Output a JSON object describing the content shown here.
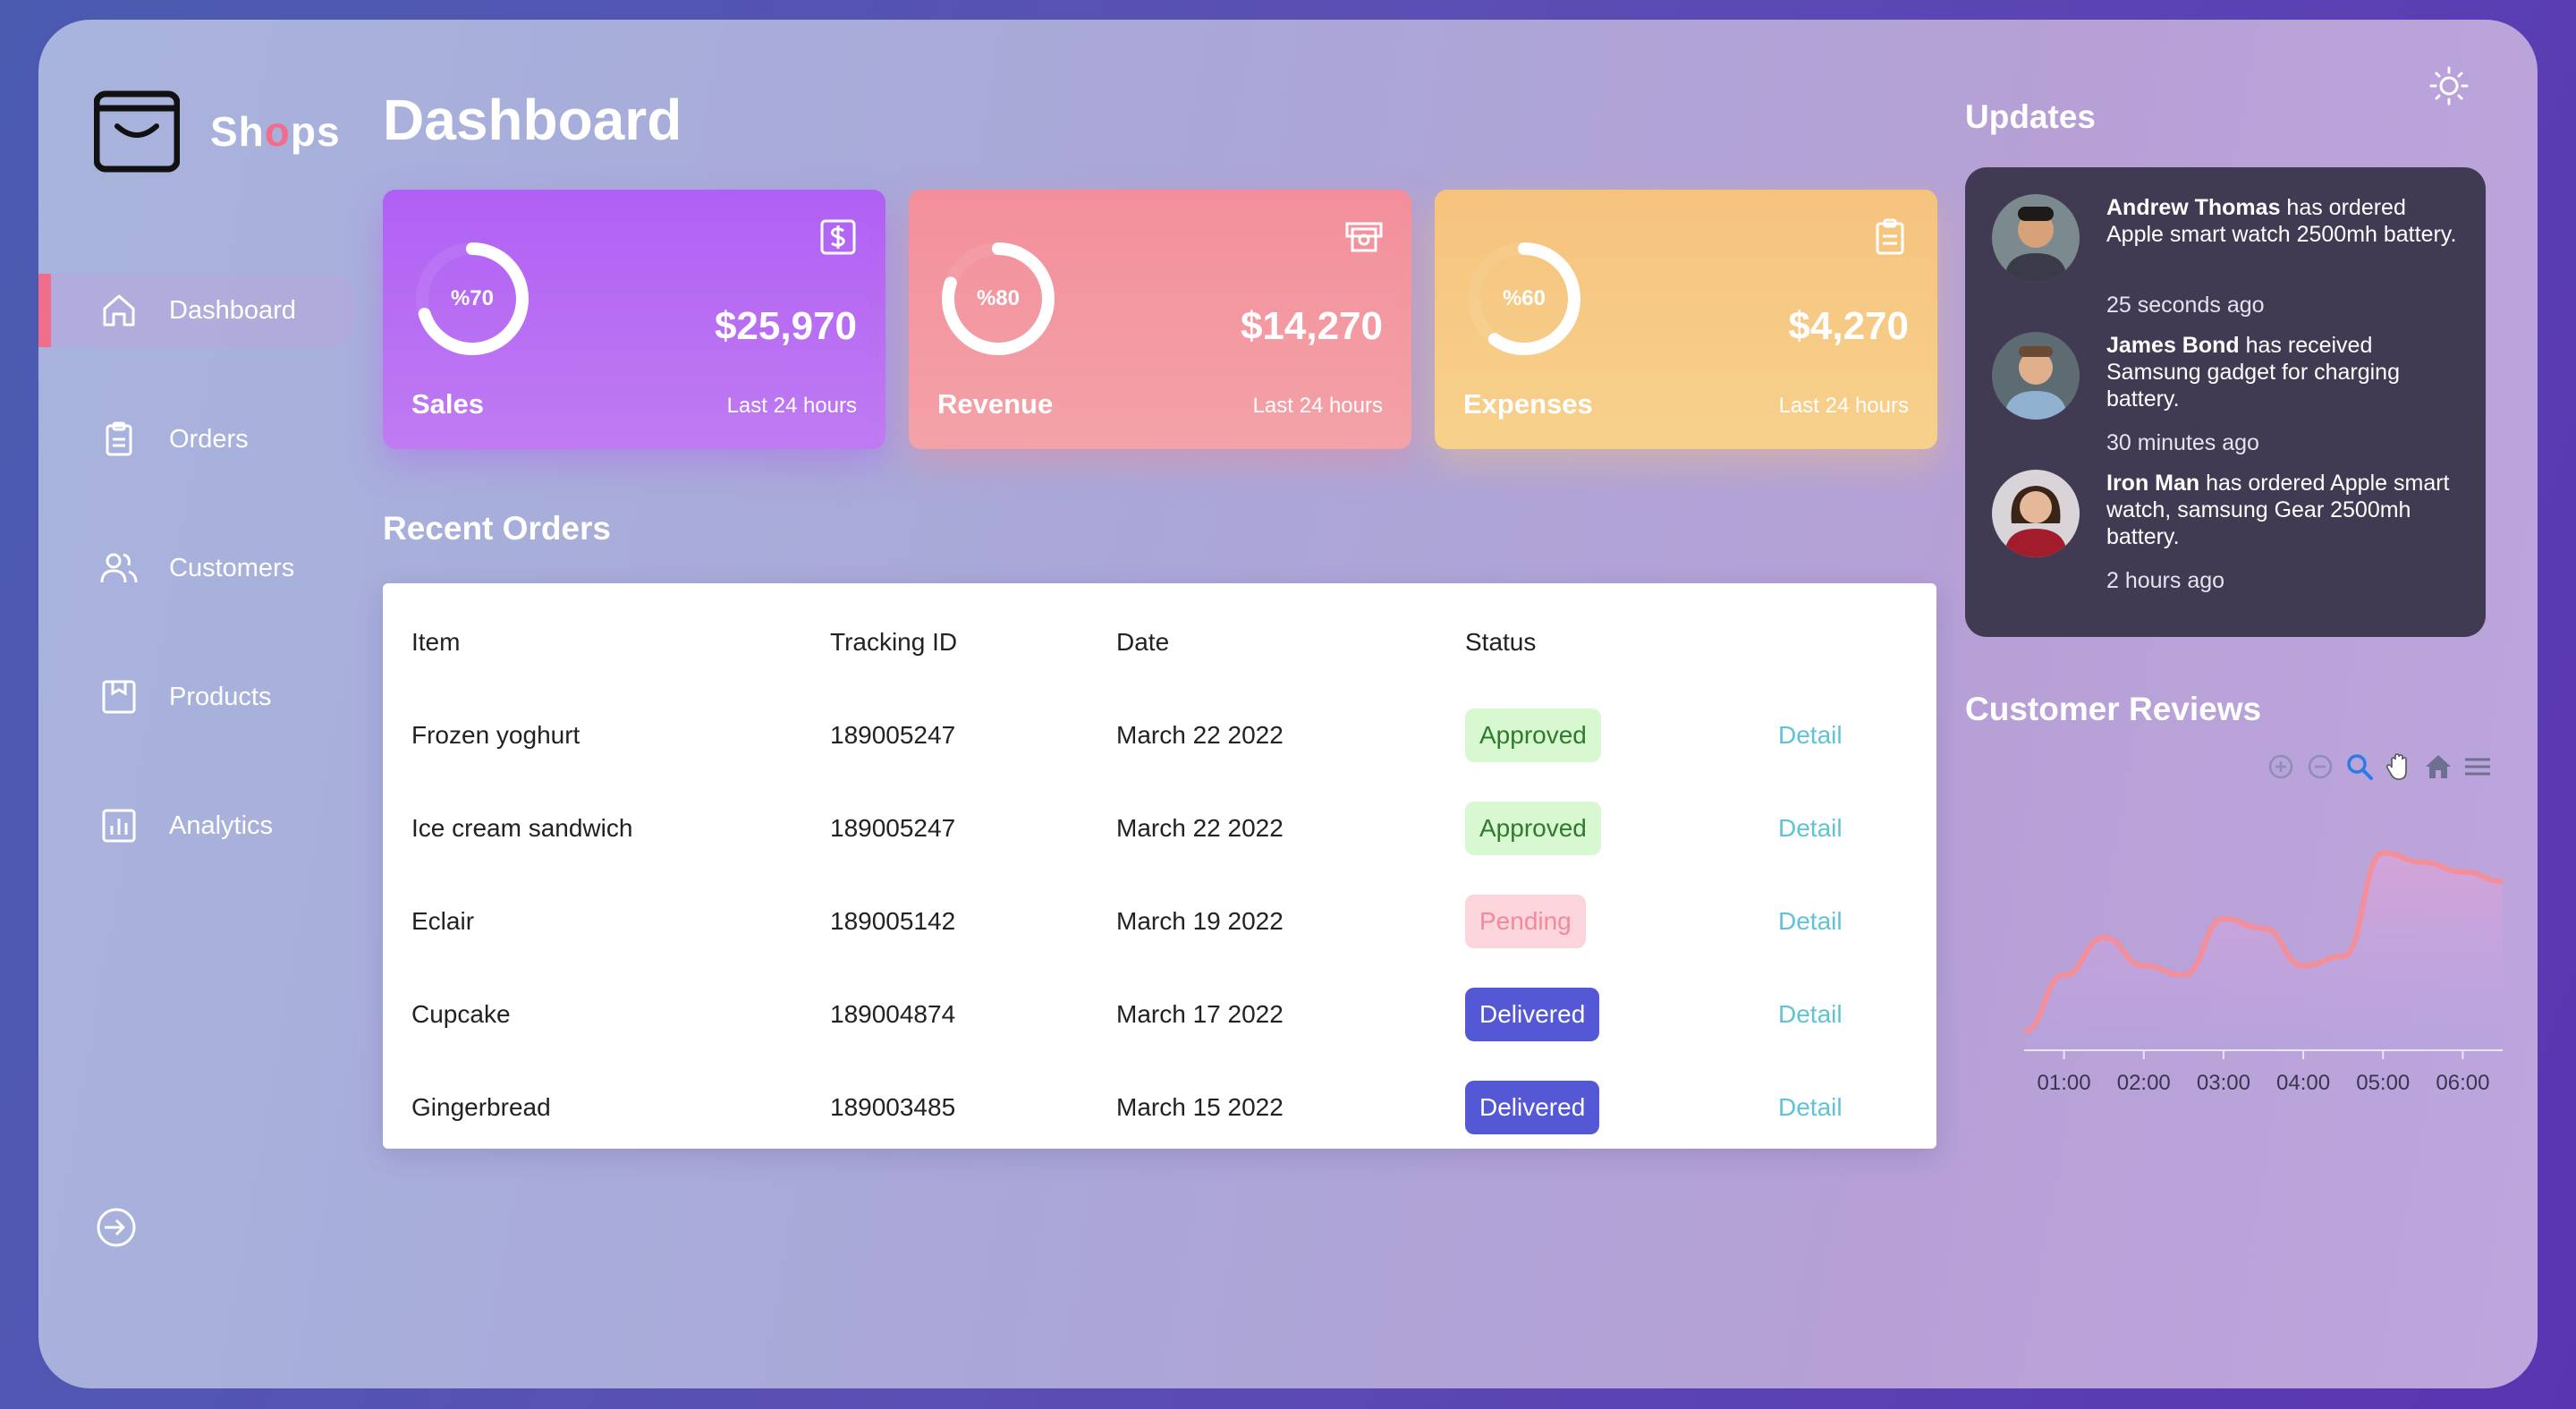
{
  "brand": {
    "name_pre": "Sh",
    "name_o": "o",
    "name_post": "ps"
  },
  "sidebar": {
    "items": [
      {
        "label": "Dashboard",
        "icon": "home-icon"
      },
      {
        "label": "Orders",
        "icon": "clipboard-icon"
      },
      {
        "label": "Customers",
        "icon": "users-icon"
      },
      {
        "label": "Products",
        "icon": "archive-icon"
      },
      {
        "label": "Analytics",
        "icon": "bar-chart-icon"
      }
    ],
    "logout_icon": "logout-icon"
  },
  "page": {
    "title": "Dashboard"
  },
  "cards": [
    {
      "label": "Sales",
      "percent": "%70",
      "percent_value": 70,
      "amount": "$25,970",
      "sub": "Last 24 hours",
      "icon": "dollar-icon",
      "color": "#b060f4"
    },
    {
      "label": "Revenue",
      "percent": "%80",
      "percent_value": 80,
      "amount": "$14,270",
      "sub": "Last 24 hours",
      "icon": "money-icon",
      "color": "#f38f9b"
    },
    {
      "label": "Expenses",
      "percent": "%60",
      "percent_value": 60,
      "amount": "$4,270",
      "sub": "Last 24 hours",
      "icon": "clipboard-icon",
      "color": "#f6c37d"
    }
  ],
  "recent_orders": {
    "title": "Recent Orders",
    "headers": {
      "item": "Item",
      "tracking": "Tracking ID",
      "date": "Date",
      "status": "Status"
    },
    "rows": [
      {
        "item": "Frozen yoghurt",
        "tracking": "189005247",
        "date": "March 22 2022",
        "status": "Approved",
        "status_key": "approved",
        "action": "Detail"
      },
      {
        "item": "Ice cream sandwich",
        "tracking": "189005247",
        "date": "March 22 2022",
        "status": "Approved",
        "status_key": "approved",
        "action": "Detail"
      },
      {
        "item": "Eclair",
        "tracking": "189005142",
        "date": "March 19 2022",
        "status": "Pending",
        "status_key": "pending",
        "action": "Detail"
      },
      {
        "item": "Cupcake",
        "tracking": "189004874",
        "date": "March 17 2022",
        "status": "Delivered",
        "status_key": "delivered",
        "action": "Detail"
      },
      {
        "item": "Gingerbread",
        "tracking": "189003485",
        "date": "March 15 2022",
        "status": "Delivered",
        "status_key": "delivered",
        "action": "Detail"
      }
    ]
  },
  "updates": {
    "title": "Updates",
    "items": [
      {
        "name": "Andrew Thomas",
        "message": " has ordered Apple smart watch 2500mh battery.",
        "time": "25 seconds ago"
      },
      {
        "name": "James Bond",
        "message": " has received Samsung gadget for charging battery.",
        "time": "30 minutes ago"
      },
      {
        "name": "Iron Man",
        "message": " has ordered Apple smart watch, samsung Gear 2500mh battery.",
        "time": "2 hours ago"
      }
    ]
  },
  "reviews": {
    "title": "Customer Reviews"
  },
  "chart_data": {
    "type": "area",
    "x": [
      "00:30",
      "01:00",
      "01:30",
      "02:00",
      "02:30",
      "03:00",
      "03:30",
      "04:00",
      "04:30",
      "05:00",
      "05:30",
      "06:00",
      "06:30"
    ],
    "x_ticks": [
      "01:00",
      "02:00",
      "03:00",
      "04:00",
      "05:00",
      "06:00"
    ],
    "series": [
      {
        "values": [
          10,
          40,
          60,
          45,
          40,
          70,
          65,
          45,
          50,
          105,
          100,
          95,
          90
        ]
      }
    ],
    "ylim": [
      0,
      120
    ],
    "color": "#f38f9b",
    "toolbar": [
      "zoom-in-icon",
      "zoom-out-icon",
      "zoom-select-icon",
      "pan-hand-icon",
      "home-icon",
      "menu-icon"
    ]
  }
}
